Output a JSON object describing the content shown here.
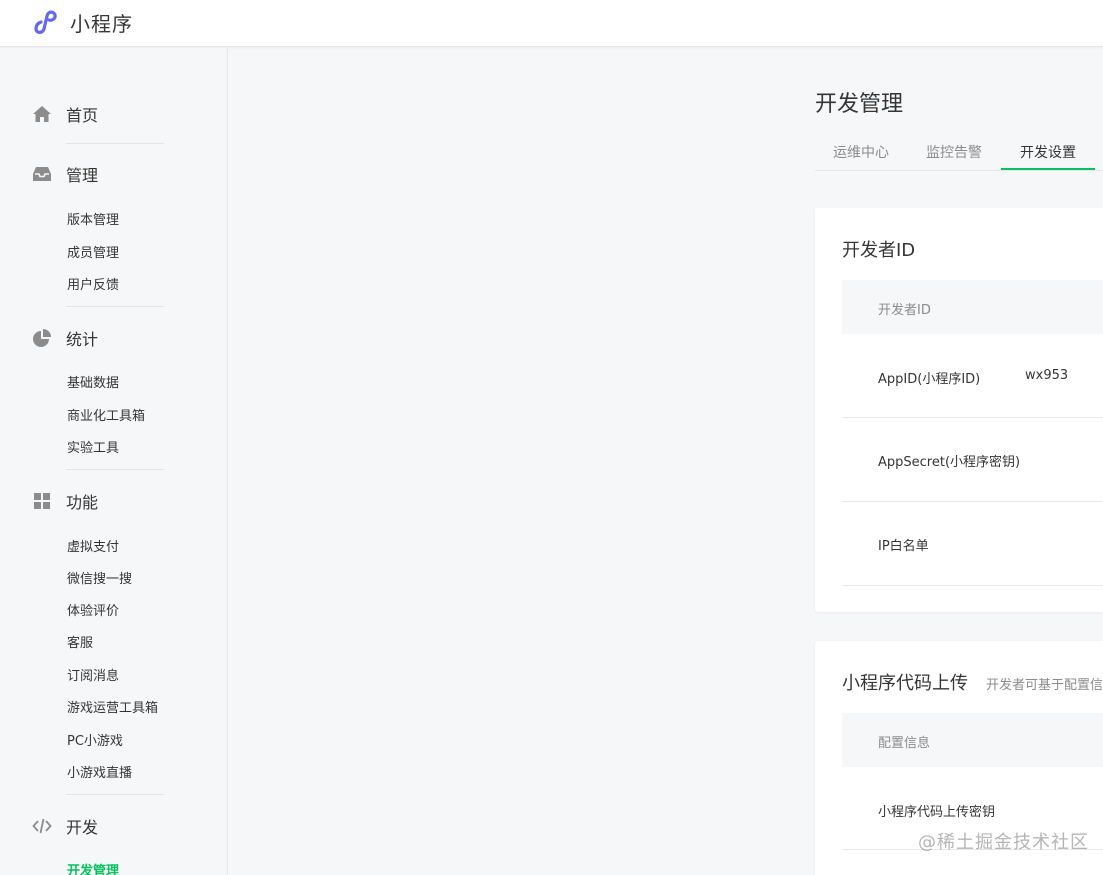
{
  "header": {
    "app_title": "小程序"
  },
  "sidebar": {
    "home": {
      "label": "首页",
      "icon": "home-icon"
    },
    "manage": {
      "label": "管理",
      "icon": "inbox-icon",
      "items": [
        "版本管理",
        "成员管理",
        "用户反馈"
      ]
    },
    "stats": {
      "label": "统计",
      "icon": "pie-chart-icon",
      "items": [
        "基础数据",
        "商业化工具箱",
        "实验工具"
      ]
    },
    "features": {
      "label": "功能",
      "icon": "grid-icon",
      "items": [
        "虚拟支付",
        "微信搜一搜",
        "体验评价",
        "客服",
        "订阅消息",
        "游戏运营工具箱",
        "PC小游戏",
        "小游戏直播"
      ]
    },
    "dev": {
      "label": "开发",
      "icon": "code-icon",
      "items": [
        "开发管理"
      ]
    }
  },
  "main": {
    "title": "开发管理",
    "tabs": [
      {
        "label": "运维中心",
        "active": false
      },
      {
        "label": "监控告警",
        "active": false
      },
      {
        "label": "开发设置",
        "active": true
      }
    ],
    "developer_id": {
      "title": "开发者ID",
      "table_header": "开发者ID",
      "rows": [
        {
          "label": "AppID(小程序ID)",
          "value": "wx953"
        },
        {
          "label": "AppSecret(小程序密钥)",
          "value": ""
        },
        {
          "label": "IP白名单",
          "value": ""
        }
      ]
    },
    "code_upload": {
      "title": "小程序代码上传",
      "subtitle": "开发者可基于配置信",
      "table_header": "配置信息",
      "rows": [
        {
          "label": "小程序代码上传密钥"
        }
      ]
    }
  },
  "watermark": "@稀土掘金技术社区",
  "colors": {
    "accent": "#07c160",
    "logo": "#6467f0",
    "text": "#353535",
    "muted": "#8c8c8c"
  }
}
